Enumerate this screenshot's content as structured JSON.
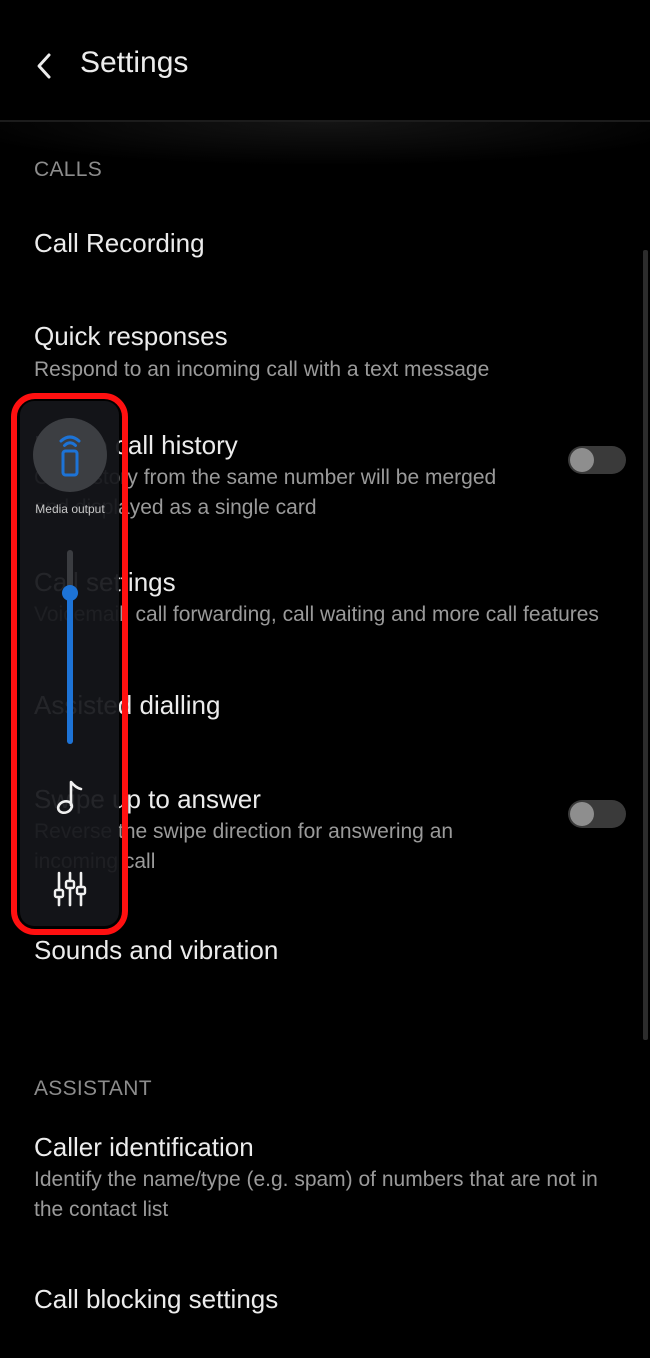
{
  "appbar": {
    "title": "Settings",
    "back_icon": "back-arrow-icon"
  },
  "sections": {
    "calls": {
      "header": "CALLS"
    },
    "assistant": {
      "header": "ASSISTANT"
    }
  },
  "items": {
    "call_recording": {
      "title": "Call Recording"
    },
    "quick_responses": {
      "title": "Quick responses",
      "subtitle": "Respond to an incoming call with a text message"
    },
    "merge_history": {
      "title": "Merge call history",
      "subtitle_line1": "Call history from the same number will be merged",
      "subtitle_line2": "and displayed as a single card",
      "toggle_on": false
    },
    "call_settings": {
      "title": "Call settings",
      "subtitle": "Voicemail, call forwarding, call waiting and more call features"
    },
    "assisted_dialling": {
      "title": "Assisted dialling"
    },
    "swipe_up": {
      "title": "Swipe up to answer",
      "subtitle_line1": "Reverse the swipe direction for answering an",
      "subtitle_line2": "incoming call",
      "toggle_on": false
    },
    "sounds_vibration": {
      "title": "Sounds and vibration"
    },
    "caller_id": {
      "title": "Caller identification",
      "subtitle_line1": "Identify the name/type (e.g. spam) of numbers that are not in",
      "subtitle_line2": "the contact list"
    },
    "call_blocking": {
      "title": "Call blocking settings"
    }
  },
  "volume_panel": {
    "media_output_label": "Media output",
    "media_output_icon": "phone-cast-icon",
    "volume_level": 0.78,
    "stream_icon": "music-note-icon",
    "settings_icon": "equalizer-icon",
    "highlight_color": "#ff1010",
    "accent_color": "#1d73d6"
  }
}
